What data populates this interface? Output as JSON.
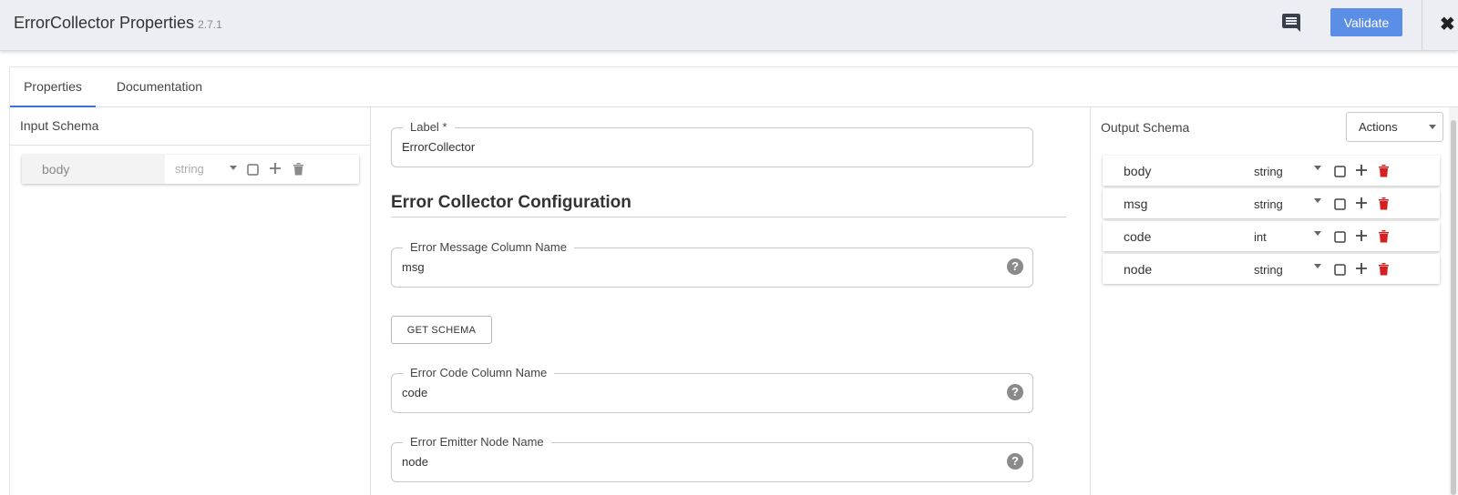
{
  "header": {
    "title": "ErrorCollector Properties",
    "version": "2.7.1",
    "validate_label": "Validate",
    "close_glyph": "✖",
    "icons": {
      "comment": "comment-icon",
      "close": "close-icon"
    },
    "accent_color": "#5b8ee6"
  },
  "tabs": [
    {
      "label": "Properties",
      "active": true
    },
    {
      "label": "Documentation",
      "active": false
    }
  ],
  "input_schema": {
    "title": "Input Schema",
    "fields": [
      {
        "name": "body",
        "type": "string"
      }
    ]
  },
  "config": {
    "label_field": {
      "legend": "Label",
      "required_mark": "*",
      "value": "ErrorCollector"
    },
    "section_title": "Error Collector Configuration",
    "message_field": {
      "legend": "Error Message Column Name",
      "value": "msg"
    },
    "get_schema_label": "GET SCHEMA",
    "code_field": {
      "legend": "Error Code Column Name",
      "value": "code"
    },
    "emitter_field": {
      "legend": "Error Emitter Node Name",
      "value": "node"
    },
    "help_glyph": "?"
  },
  "output_schema": {
    "title": "Output Schema",
    "actions_label": "Actions",
    "delete_color": "#d61f1f",
    "fields": [
      {
        "name": "body",
        "type": "string"
      },
      {
        "name": "msg",
        "type": "string"
      },
      {
        "name": "code",
        "type": "int"
      },
      {
        "name": "node",
        "type": "string"
      }
    ]
  }
}
